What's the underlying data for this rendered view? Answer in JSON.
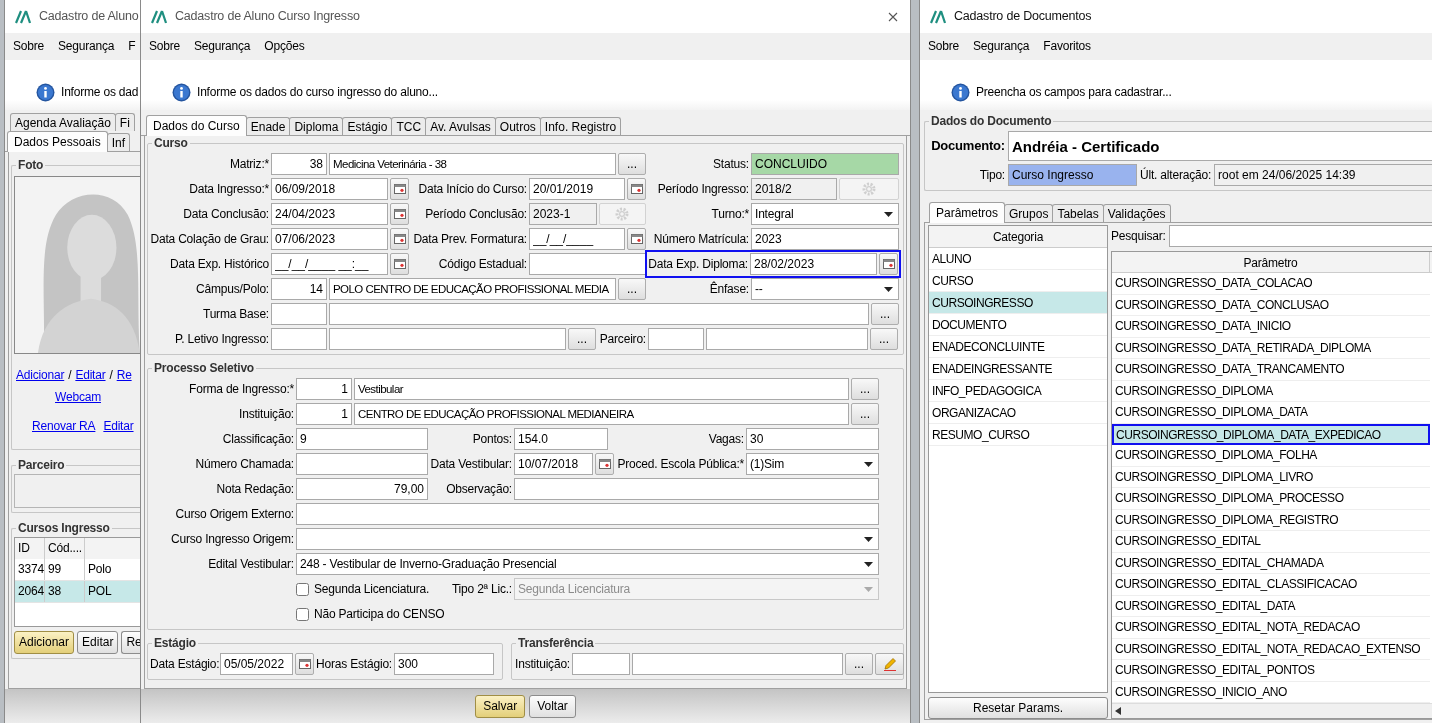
{
  "student_window": {
    "title": "Cadastro de Aluno",
    "menu": [
      "Sobre",
      "Segurança",
      "F"
    ],
    "info": "Informe os dad",
    "tabs_back": [
      {
        "label": "Agenda Avaliação",
        "selected": false
      },
      {
        "label": "Fi",
        "selected": false
      }
    ],
    "tabs_front": [
      {
        "label": "Dados Pessoais",
        "selected": true
      },
      {
        "label": "Inf",
        "selected": false
      }
    ],
    "foto": {
      "title": "Foto",
      "links": [
        {
          "kind": "link",
          "text": "Adicionar"
        },
        {
          "kind": "separator",
          "text": "/"
        },
        {
          "kind": "link",
          "text": "Editar"
        },
        {
          "kind": "separator",
          "text": "/"
        },
        {
          "kind": "link",
          "text": "Re"
        }
      ],
      "webcam": "Webcam",
      "links_bottom": [
        "Renovar RA",
        "Editar"
      ]
    },
    "parceiro": {
      "title": "Parceiro"
    },
    "cursos": {
      "title": "Cursos Ingresso",
      "columns": [
        "ID",
        "Cód...."
      ],
      "rows": [
        {
          "cells": [
            "3374",
            "99",
            "Polo"
          ],
          "selected": false
        },
        {
          "cells": [
            "2064",
            "38",
            "POL"
          ],
          "selected": true
        }
      ],
      "buttons": [
        {
          "label": "Adicionar",
          "default": true
        },
        {
          "label": "Editar",
          "default": false
        },
        {
          "label": "Re",
          "default": false
        }
      ]
    }
  },
  "course_window": {
    "title": "Cadastro de Aluno Curso Ingresso",
    "menu": [
      "Sobre",
      "Segurança",
      "Opções"
    ],
    "info": "Informe os dados do curso ingresso do aluno...",
    "tabs": [
      {
        "label": "Dados do Curso",
        "selected": true
      },
      {
        "label": "Enade",
        "selected": false
      },
      {
        "label": "Diploma",
        "selected": false
      },
      {
        "label": "Estágio",
        "selected": false
      },
      {
        "label": "TCC",
        "selected": false
      },
      {
        "label": "Av. Avulsas",
        "selected": false
      },
      {
        "label": "Outros",
        "selected": false
      },
      {
        "label": "Info. Registro",
        "selected": false
      }
    ],
    "curso": {
      "title": "Curso",
      "rows": [
        [
          {
            "kind": "lookup",
            "label": "Matriz:*",
            "code": "38",
            "value": "Medicina Veterinária - 38",
            "button": "...",
            "highlighted": false
          },
          {
            "kind": "status",
            "label": "Status:",
            "value": "CONCLUIDO",
            "highlighted": false
          }
        ],
        [
          {
            "kind": "date",
            "label": "Data Ingresso:*",
            "value": "06/09/2018",
            "highlighted": false
          },
          {
            "kind": "date",
            "label": "Data Início do Curso:",
            "value": "20/01/2019",
            "highlighted": false
          },
          {
            "kind": "period",
            "label": "Período Ingresso:",
            "value": "2018/2",
            "highlighted": false
          }
        ],
        [
          {
            "kind": "date",
            "label": "Data Conclusão:",
            "value": "24/04/2023",
            "highlighted": false
          },
          {
            "kind": "period",
            "label": "Período Conclusão:",
            "value": "2023-1",
            "highlighted": false
          },
          {
            "kind": "select",
            "label": "Turno:*",
            "value": "Integral",
            "disabled": false,
            "highlighted": false
          }
        ],
        [
          {
            "kind": "date",
            "label": "Data Colação de Grau:",
            "value": "07/06/2023",
            "highlighted": false
          },
          {
            "kind": "date",
            "label": "Data Prev. Formatura:",
            "value": "__/__/____",
            "highlighted": false
          },
          {
            "kind": "text",
            "label": "Número Matrícula:",
            "value": "2023",
            "highlighted": false
          }
        ],
        [
          {
            "kind": "date",
            "label": "Data Exp. Histórico",
            "value": "__/__/____ __:__",
            "highlighted": false
          },
          {
            "kind": "text",
            "label": "Código Estadual:",
            "highlighted": false
          },
          {
            "kind": "date",
            "label": "Data Exp. Diploma:",
            "value": "28/02/2023",
            "highlighted": true
          }
        ],
        [
          {
            "kind": "lookup",
            "label": "Câmpus/Polo:",
            "code": "14",
            "value": "POLO CENTRO DE EDUCAÇÃO PROFISSIONAL MEDIA",
            "button": "...",
            "highlighted": false
          },
          {
            "kind": "select",
            "label": "Ênfase:",
            "value": "--",
            "disabled": false,
            "highlighted": false
          }
        ],
        [
          {
            "kind": "lookup",
            "label": "Turma Base:",
            "button": "...",
            "highlighted": false
          }
        ],
        [
          {
            "kind": "lookup",
            "label": "P. Letivo Ingresso:",
            "button": "...",
            "highlighted": false
          },
          {
            "kind": "lookup",
            "label": "Parceiro:",
            "button": "...",
            "highlighted": false
          }
        ]
      ]
    },
    "processo": {
      "title": "Processo Seletivo",
      "rows": [
        [
          {
            "kind": "lookup",
            "label": "Forma de Ingresso:*",
            "code": "1",
            "value": "Vestibular",
            "button": "..."
          }
        ],
        [
          {
            "kind": "lookup",
            "label": "Instituição:",
            "code": "1",
            "value": "CENTRO DE EDUCAÇÃO PROFISSIONAL MEDIANEIRA",
            "button": "..."
          }
        ],
        [
          {
            "kind": "text",
            "label": "Classificação:",
            "value": "9"
          },
          {
            "kind": "text",
            "label": "Pontos:",
            "value": "154.0"
          },
          {
            "kind": "text",
            "label": "Vagas:",
            "value": "30"
          }
        ],
        [
          {
            "kind": "text",
            "label": "Número Chamada:"
          },
          {
            "kind": "date",
            "label": "Data Vestibular:",
            "value": "10/07/2018"
          },
          {
            "kind": "select",
            "label": "Proced. Escola Pública:*",
            "value": "(1)Sim",
            "disabled": false
          }
        ],
        [
          {
            "kind": "number",
            "label": "Nota Redação:",
            "value": "79,00"
          },
          {
            "kind": "text",
            "label": "Observação:"
          }
        ],
        [
          {
            "kind": "text",
            "label": "Curso Origem Externo:"
          }
        ],
        [
          {
            "kind": "select",
            "label": "Curso Ingresso Origem:",
            "disabled": false
          }
        ],
        [
          {
            "kind": "select",
            "label": "Edital Vestibular:",
            "value": "248 - Vestibular de Inverno-Graduação Presencial",
            "disabled": false
          }
        ],
        [
          {
            "kind": "checkbox",
            "text": "Segunda Licenciatura.",
            "checked": false
          },
          {
            "kind": "select",
            "label": "Tipo 2ª Lic.:",
            "value": "Segunda Licenciatura",
            "disabled": true
          }
        ],
        [
          {
            "kind": "checkbox",
            "text": "Não Participa do CENSO",
            "checked": false
          }
        ]
      ]
    },
    "estagio": {
      "title": "Estágio",
      "rows": [
        [
          {
            "kind": "date",
            "label": "Data Estágio:",
            "value": "05/05/2022"
          },
          {
            "kind": "text",
            "label": "Horas Estágio:",
            "value": "300"
          }
        ]
      ]
    },
    "transferencia": {
      "title": "Transferência",
      "rows": [
        [
          {
            "kind": "lookup",
            "label": "Instituição:",
            "button": "...",
            "editable": true
          }
        ]
      ]
    },
    "buttons": [
      {
        "label": "Salvar",
        "default": true
      },
      {
        "label": "Voltar",
        "default": false
      }
    ]
  },
  "document_window": {
    "title": "Cadastro de Documentos",
    "menu": [
      "Sobre",
      "Segurança",
      "Favoritos"
    ],
    "info": "Preencha os campos para cadastrar...",
    "group_title": "Dados do Documento",
    "document_label": "Documento:",
    "document_value": "Andréia - Certificado",
    "tipo_label": "Tipo:",
    "tipo_value": "Curso Ingresso",
    "alteracao_label": "Últ. alteração:",
    "alteracao_value": "root em 24/06/2025 14:39",
    "tabs": [
      {
        "label": "Parâmetros",
        "selected": true
      },
      {
        "label": "Grupos",
        "selected": false
      },
      {
        "label": "Tabelas",
        "selected": false
      },
      {
        "label": "Validações",
        "selected": false
      }
    ],
    "categoria_header": "Categoria",
    "categorias": [
      {
        "text": "ALUNO",
        "selected": false
      },
      {
        "text": "CURSO",
        "selected": false
      },
      {
        "text": "CURSOINGRESSO",
        "selected": true
      },
      {
        "text": "DOCUMENTO",
        "selected": false
      },
      {
        "text": "ENADECONCLUINTE",
        "selected": false
      },
      {
        "text": "ENADEINGRESSANTE",
        "selected": false
      },
      {
        "text": "INFO_PEDAGOGICA",
        "selected": false
      },
      {
        "text": "ORGANIZACAO",
        "selected": false
      },
      {
        "text": "RESUMO_CURSO",
        "selected": false
      }
    ],
    "reset_button": "Resetar Params.",
    "search_label": "Pesquisar:",
    "parametro_header": "Parâmetro",
    "parametros": [
      {
        "text": "CURSOINGRESSO_DATA_COLACAO",
        "selected": false
      },
      {
        "text": "CURSOINGRESSO_DATA_CONCLUSAO",
        "selected": false
      },
      {
        "text": "CURSOINGRESSO_DATA_INICIO",
        "selected": false
      },
      {
        "text": "CURSOINGRESSO_DATA_RETIRADA_DIPLOMA",
        "selected": false
      },
      {
        "text": "CURSOINGRESSO_DATA_TRANCAMENTO",
        "selected": false
      },
      {
        "text": "CURSOINGRESSO_DIPLOMA",
        "selected": false
      },
      {
        "text": "CURSOINGRESSO_DIPLOMA_DATA",
        "selected": false
      },
      {
        "text": "CURSOINGRESSO_DIPLOMA_DATA_EXPEDICAO",
        "selected": true
      },
      {
        "text": "CURSOINGRESSO_DIPLOMA_FOLHA",
        "selected": false
      },
      {
        "text": "CURSOINGRESSO_DIPLOMA_LIVRO",
        "selected": false
      },
      {
        "text": "CURSOINGRESSO_DIPLOMA_PROCESSO",
        "selected": false
      },
      {
        "text": "CURSOINGRESSO_DIPLOMA_REGISTRO",
        "selected": false
      },
      {
        "text": "CURSOINGRESSO_EDITAL",
        "selected": false
      },
      {
        "text": "CURSOINGRESSO_EDITAL_CHAMADA",
        "selected": false
      },
      {
        "text": "CURSOINGRESSO_EDITAL_CLASSIFICACAO",
        "selected": false
      },
      {
        "text": "CURSOINGRESSO_EDITAL_DATA",
        "selected": false
      },
      {
        "text": "CURSOINGRESSO_EDITAL_NOTA_REDACAO",
        "selected": false
      },
      {
        "text": "CURSOINGRESSO_EDITAL_NOTA_REDACAO_EXTENSO",
        "selected": false
      },
      {
        "text": "CURSOINGRESSO_EDITAL_PONTOS",
        "selected": false
      },
      {
        "text": "CURSOINGRESSO_INICIO_ANO",
        "selected": false
      }
    ]
  }
}
